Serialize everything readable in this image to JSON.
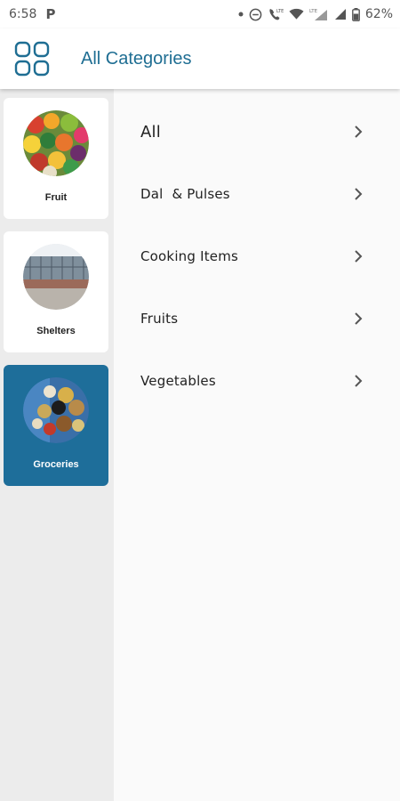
{
  "status_bar": {
    "time": "6:58",
    "app_glyph": "P",
    "battery_pct": "62%",
    "icons": [
      "dot-icon",
      "do-not-disturb-icon",
      "wifi-call-icon",
      "wifi-icon",
      "lte-signal-icon",
      "signal-icon",
      "battery-icon"
    ],
    "lte_label": "LTE"
  },
  "app_bar": {
    "title": "All Categories",
    "menu_icon": "grid-menu-icon",
    "accent_color": "#1f6e93"
  },
  "categories": [
    {
      "label": "Fruit",
      "thumb": "fruit-thumbnail",
      "selected": false
    },
    {
      "label": "Shelters",
      "thumb": "shelter-thumbnail",
      "selected": false
    },
    {
      "label": "Groceries",
      "thumb": "groceries-thumbnail",
      "selected": true
    }
  ],
  "selected_color": "#1e6e9a",
  "subcategories": [
    {
      "label": "All"
    },
    {
      "label": "Dal  & Pulses"
    },
    {
      "label": "Cooking Items"
    },
    {
      "label": "Fruits"
    },
    {
      "label": "Vegetables"
    }
  ]
}
